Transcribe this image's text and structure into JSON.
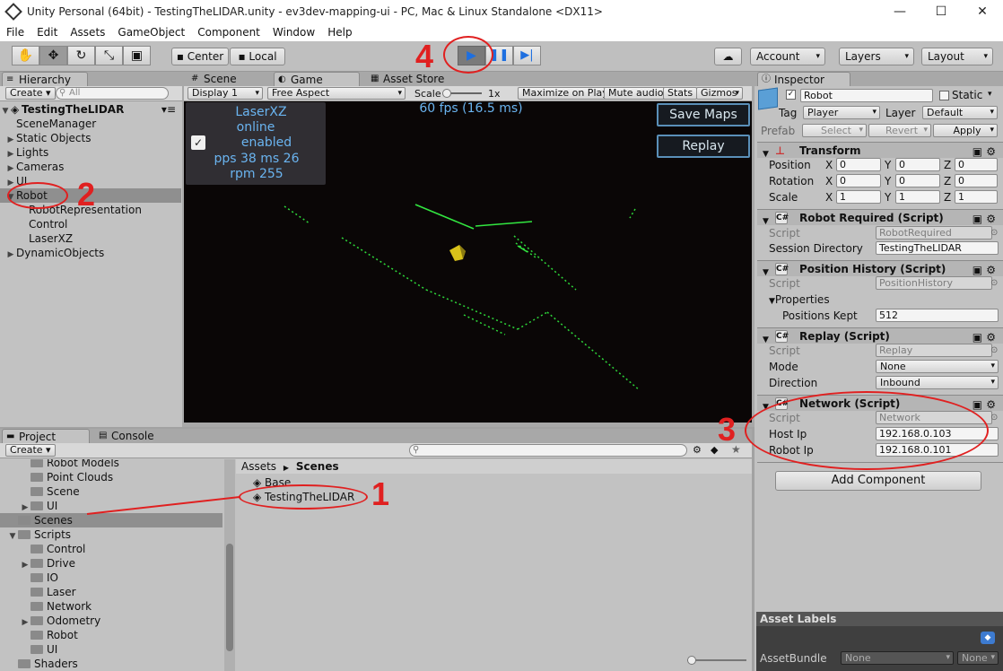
{
  "window": {
    "title": "Unity Personal (64bit) - TestingTheLIDAR.unity - ev3dev-mapping-ui - PC, Mac & Linux Standalone <DX11>",
    "minimize": "—",
    "maximize": "☐",
    "close": "✕"
  },
  "menu": [
    "File",
    "Edit",
    "Assets",
    "GameObject",
    "Component",
    "Window",
    "Help"
  ],
  "toolbar": {
    "pivot": "Center",
    "space": "Local",
    "account": "Account",
    "layers": "Layers",
    "layout": "Layout"
  },
  "hierarchy": {
    "tab": "Hierarchy",
    "create": "Create",
    "search_placeholder": "All",
    "scene": "TestingTheLIDAR",
    "items": [
      {
        "label": "SceneManager",
        "indent": 0,
        "arrow": ""
      },
      {
        "label": "Static Objects",
        "indent": 0,
        "arrow": "▶"
      },
      {
        "label": "Lights",
        "indent": 0,
        "arrow": "▶"
      },
      {
        "label": "Cameras",
        "indent": 0,
        "arrow": "▶"
      },
      {
        "label": "UI",
        "indent": 0,
        "arrow": "▶"
      },
      {
        "label": "Robot",
        "indent": 0,
        "arrow": "▼"
      },
      {
        "label": "RobotRepresentation",
        "indent": 1,
        "arrow": ""
      },
      {
        "label": "Control",
        "indent": 1,
        "arrow": ""
      },
      {
        "label": "LaserXZ",
        "indent": 1,
        "arrow": ""
      },
      {
        "label": "DynamicObjects",
        "indent": 0,
        "arrow": "▶"
      }
    ]
  },
  "center_tabs": [
    "Scene",
    "Game",
    "Asset Store"
  ],
  "game_bar": {
    "display": "Display 1",
    "aspect": "Free Aspect",
    "scale_label": "Scale",
    "scale_value": "1x",
    "maximize": "Maximize on Play",
    "mute": "Mute audio",
    "stats": "Stats",
    "gizmos": "Gizmos"
  },
  "game_overlay": {
    "name": "LaserXZ",
    "status": "online",
    "enabled": "enabled",
    "pps": "pps 38 ms 26",
    "rpm": "rpm 255",
    "fps": "60 fps (16.5 ms)",
    "save_maps": "Save Maps",
    "replay": "Replay"
  },
  "project": {
    "tabs": [
      "Project",
      "Console"
    ],
    "create": "Create",
    "tree": [
      {
        "label": "Robot Models",
        "indent": 2,
        "arrow": ""
      },
      {
        "label": "Point Clouds",
        "indent": 2,
        "arrow": ""
      },
      {
        "label": "Scene",
        "indent": 2,
        "arrow": ""
      },
      {
        "label": "UI",
        "indent": 2,
        "arrow": "▶"
      },
      {
        "label": "Scenes",
        "indent": 1,
        "arrow": ""
      },
      {
        "label": "Scripts",
        "indent": 1,
        "arrow": "▼"
      },
      {
        "label": "Control",
        "indent": 2,
        "arrow": ""
      },
      {
        "label": "Drive",
        "indent": 2,
        "arrow": "▶"
      },
      {
        "label": "IO",
        "indent": 2,
        "arrow": ""
      },
      {
        "label": "Laser",
        "indent": 2,
        "arrow": ""
      },
      {
        "label": "Network",
        "indent": 2,
        "arrow": ""
      },
      {
        "label": "Odometry",
        "indent": 2,
        "arrow": "▶"
      },
      {
        "label": "Robot",
        "indent": 2,
        "arrow": ""
      },
      {
        "label": "UI",
        "indent": 2,
        "arrow": ""
      },
      {
        "label": "Shaders",
        "indent": 1,
        "arrow": ""
      }
    ],
    "breadcrumb_root": "Assets",
    "breadcrumb_sep": "▶",
    "breadcrumb_current": "Scenes",
    "files": [
      "Base",
      "TestingTheLIDAR"
    ]
  },
  "inspector": {
    "tab": "Inspector",
    "object_name": "Robot",
    "static": "Static",
    "tag_label": "Tag",
    "tag": "Player",
    "layer_label": "Layer",
    "layer": "Default",
    "prefab_label": "Prefab",
    "prefab_select": "Select",
    "prefab_revert": "Revert",
    "prefab_apply": "Apply",
    "transform": {
      "title": "Transform",
      "position": "Position",
      "rotation": "Rotation",
      "scale": "Scale",
      "pos": [
        "0",
        "0",
        "0"
      ],
      "rot": [
        "0",
        "0",
        "0"
      ],
      "scl": [
        "1",
        "1",
        "1"
      ],
      "axes": [
        "X",
        "Y",
        "Z"
      ]
    },
    "robot_required": {
      "title": "Robot Required (Script)",
      "script_label": "Script",
      "script": "RobotRequired",
      "dir_label": "Session Directory",
      "dir": "TestingTheLIDAR"
    },
    "position_history": {
      "title": "Position History (Script)",
      "script_label": "Script",
      "script": "PositionHistory",
      "props_label": "Properties",
      "kept_label": "Positions Kept",
      "kept": "512"
    },
    "replay": {
      "title": "Replay (Script)",
      "script_label": "Script",
      "script": "Replay",
      "mode_label": "Mode",
      "mode": "None",
      "dir_label": "Direction",
      "dir": "Inbound"
    },
    "network": {
      "title": "Network (Script)",
      "script_label": "Script",
      "script": "Network",
      "host_label": "Host Ip",
      "host": "192.168.0.103",
      "robot_label": "Robot Ip",
      "robot": "192.168.0.101"
    },
    "add_component": "Add Component",
    "asset_labels": "Asset Labels",
    "asset_bundle_label": "AssetBundle",
    "asset_bundle": "None",
    "asset_bundle_variant": "None"
  },
  "annotations": [
    "1",
    "2",
    "3",
    "4"
  ]
}
